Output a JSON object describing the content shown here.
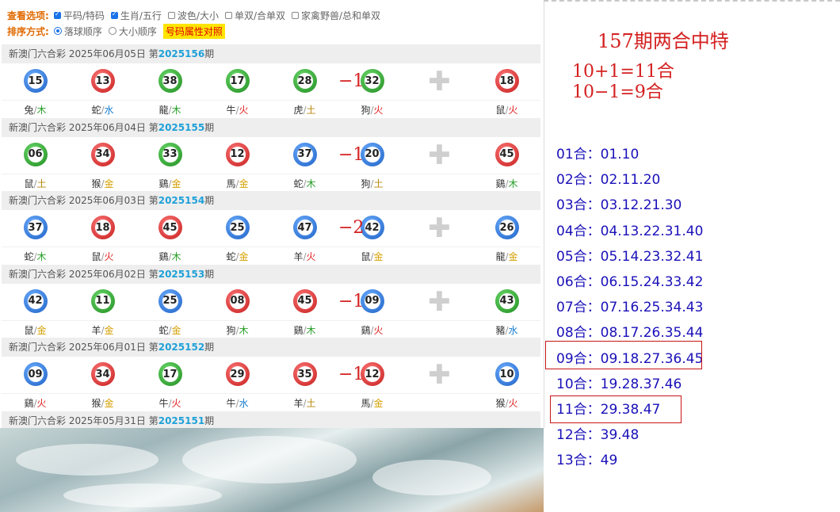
{
  "options": {
    "view_label": "查看选项:",
    "view_items": [
      {
        "label": "平码/特码",
        "checked": true
      },
      {
        "label": "生肖/五行",
        "checked": true
      },
      {
        "label": "波色/大小",
        "checked": false
      },
      {
        "label": "单双/合单双",
        "checked": false
      },
      {
        "label": "家禽野兽/总和单双",
        "checked": false
      }
    ],
    "sort_label": "排序方式:",
    "sort_items": [
      {
        "label": "落球顺序",
        "selected": true
      },
      {
        "label": "大小顺序",
        "selected": false
      }
    ],
    "compare_button": "号码属性对照"
  },
  "draws": [
    {
      "header_prefix": "新澳门六合彩 2025年06月05日 第",
      "issue": "2025156",
      "header_suffix": "期",
      "annotation": "−1",
      "balls": [
        {
          "num": "15",
          "color": "blue",
          "zodiac": "兔",
          "element": "木",
          "el": "wood"
        },
        {
          "num": "13",
          "color": "red",
          "zodiac": "蛇",
          "element": "水",
          "el": "water"
        },
        {
          "num": "38",
          "color": "green",
          "zodiac": "龍",
          "element": "木",
          "el": "wood"
        },
        {
          "num": "17",
          "color": "green",
          "zodiac": "牛",
          "element": "火",
          "el": "fire"
        },
        {
          "num": "28",
          "color": "green",
          "zodiac": "虎",
          "element": "土",
          "el": "earth"
        },
        {
          "num": "32",
          "color": "green",
          "zodiac": "狗",
          "element": "火",
          "el": "fire"
        }
      ],
      "special": {
        "num": "18",
        "color": "red",
        "zodiac": "鼠",
        "element": "火",
        "el": "fire"
      }
    },
    {
      "header_prefix": "新澳门六合彩 2025年06月04日 第",
      "issue": "2025155",
      "header_suffix": "期",
      "annotation": "−1",
      "balls": [
        {
          "num": "06",
          "color": "green",
          "zodiac": "鼠",
          "element": "土",
          "el": "earth"
        },
        {
          "num": "34",
          "color": "red",
          "zodiac": "猴",
          "element": "金",
          "el": "gold"
        },
        {
          "num": "33",
          "color": "green",
          "zodiac": "鷄",
          "element": "金",
          "el": "gold"
        },
        {
          "num": "12",
          "color": "red",
          "zodiac": "馬",
          "element": "金",
          "el": "gold"
        },
        {
          "num": "37",
          "color": "blue",
          "zodiac": "蛇",
          "element": "木",
          "el": "wood"
        },
        {
          "num": "20",
          "color": "blue",
          "zodiac": "狗",
          "element": "土",
          "el": "earth"
        }
      ],
      "special": {
        "num": "45",
        "color": "red",
        "zodiac": "鷄",
        "element": "木",
        "el": "wood"
      }
    },
    {
      "header_prefix": "新澳门六合彩 2025年06月03日 第",
      "issue": "2025154",
      "header_suffix": "期",
      "annotation": "−2",
      "balls": [
        {
          "num": "37",
          "color": "blue",
          "zodiac": "蛇",
          "element": "木",
          "el": "wood"
        },
        {
          "num": "18",
          "color": "red",
          "zodiac": "鼠",
          "element": "火",
          "el": "fire"
        },
        {
          "num": "45",
          "color": "red",
          "zodiac": "鷄",
          "element": "木",
          "el": "wood"
        },
        {
          "num": "25",
          "color": "blue",
          "zodiac": "蛇",
          "element": "金",
          "el": "gold"
        },
        {
          "num": "47",
          "color": "blue",
          "zodiac": "羊",
          "element": "火",
          "el": "fire"
        },
        {
          "num": "42",
          "color": "blue",
          "zodiac": "鼠",
          "element": "金",
          "el": "gold"
        }
      ],
      "special": {
        "num": "26",
        "color": "blue",
        "zodiac": "龍",
        "element": "金",
        "el": "gold"
      }
    },
    {
      "header_prefix": "新澳门六合彩 2025年06月02日 第",
      "issue": "2025153",
      "header_suffix": "期",
      "annotation": "−1",
      "balls": [
        {
          "num": "42",
          "color": "blue",
          "zodiac": "鼠",
          "element": "金",
          "el": "gold"
        },
        {
          "num": "11",
          "color": "green",
          "zodiac": "羊",
          "element": "金",
          "el": "gold"
        },
        {
          "num": "25",
          "color": "blue",
          "zodiac": "蛇",
          "element": "金",
          "el": "gold"
        },
        {
          "num": "08",
          "color": "red",
          "zodiac": "狗",
          "element": "木",
          "el": "wood"
        },
        {
          "num": "45",
          "color": "red",
          "zodiac": "鷄",
          "element": "木",
          "el": "wood"
        },
        {
          "num": "09",
          "color": "blue",
          "zodiac": "鷄",
          "element": "火",
          "el": "fire"
        }
      ],
      "special": {
        "num": "43",
        "color": "green",
        "zodiac": "豬",
        "element": "水",
        "el": "water"
      }
    },
    {
      "header_prefix": "新澳门六合彩 2025年06月01日 第",
      "issue": "2025152",
      "header_suffix": "期",
      "annotation": "−1",
      "balls": [
        {
          "num": "09",
          "color": "blue",
          "zodiac": "鷄",
          "element": "火",
          "el": "fire"
        },
        {
          "num": "34",
          "color": "red",
          "zodiac": "猴",
          "element": "金",
          "el": "gold"
        },
        {
          "num": "17",
          "color": "green",
          "zodiac": "牛",
          "element": "火",
          "el": "fire"
        },
        {
          "num": "29",
          "color": "red",
          "zodiac": "牛",
          "element": "水",
          "el": "water"
        },
        {
          "num": "35",
          "color": "red",
          "zodiac": "羊",
          "element": "土",
          "el": "earth"
        },
        {
          "num": "12",
          "color": "red",
          "zodiac": "馬",
          "element": "金",
          "el": "gold"
        }
      ],
      "special": {
        "num": "10",
        "color": "blue",
        "zodiac": "猴",
        "element": "火",
        "el": "fire"
      }
    }
  ],
  "last_header": {
    "prefix": "新澳门六合彩 2025年05月31日 第",
    "issue": "2025151",
    "suffix": "期"
  },
  "right": {
    "title": "157期两合中特",
    "formula1": "10+1=11合",
    "formula2": "10−1=9合",
    "he_list": [
      "01合：01.10",
      "02合：02.11.20",
      "03合：03.12.21.30",
      "04合：04.13.22.31.40",
      "05合：05.14.23.32.41",
      "06合：06.15.24.33.42",
      "07合：07.16.25.34.43",
      "08合：08.17.26.35.44",
      "09合：09.18.27.36.45",
      "10合：19.28.37.46",
      "11合：29.38.47",
      "12合：39.48",
      "13合：49"
    ]
  }
}
